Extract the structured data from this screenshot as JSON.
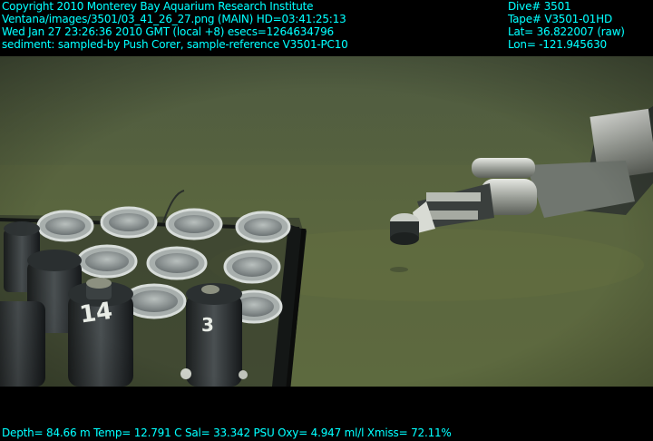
{
  "overlay": {
    "top_left": [
      "Copyright 2010 Monterey Bay Aquarium Research Institute",
      "Ventana/images/3501/03_41_26_27.png (MAIN)  HD=03:41:25:13",
      "Wed Jan 27 23:26:36 2010 GMT (local +8)  esecs=1264634796",
      "sediment: sampled-by Push Corer, sample-reference V3501-PC10"
    ],
    "top_right": [
      "Dive# 3501",
      "Tape# V3501-01HD",
      "Lat= 36.822007 (raw)",
      "Lon= -121.945630"
    ],
    "bottom": "Depth= 84.66 m  Temp= 12.791 C  Sal= 33.342 PSU  Oxy= 4.947 ml/l  Xmiss= 72.11%"
  },
  "scene": {
    "core_labels": [
      "14",
      "3"
    ],
    "colors": {
      "water": "#4f5b40",
      "sediment": "#5d6a40",
      "text": "#00ffff"
    }
  }
}
